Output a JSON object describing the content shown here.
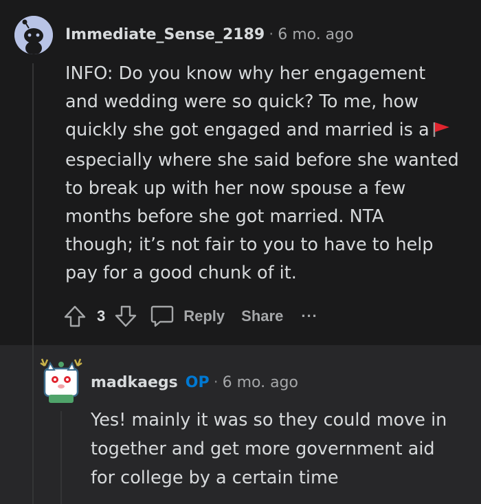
{
  "comment": {
    "username": "Immediate_Sense_2189",
    "separator": "·",
    "timestamp": "6 mo. ago",
    "avatar_icon": "reddit-snoo-avatar-icon",
    "body_lines": [
      "INFO: Do you know why her engagement",
      "and wedding were so quick? To me, how",
      "quickly she got engaged and married is a",
      "especially where she said before she wanted",
      "to break up with her now spouse a few",
      "months before she got married. NTA",
      "though; it’s not fair to you to have to help",
      "pay for a good chunk of it."
    ],
    "red_flag_icon": "red-flag-icon",
    "vote_count": "3",
    "reply_label": "Reply",
    "share_label": "Share",
    "more_label": "..."
  },
  "reply": {
    "username": "madkaegs",
    "op_badge": "OP",
    "separator": "·",
    "timestamp": "6 mo. ago",
    "avatar_icon": "snoo-cat-avatar-icon",
    "body_lines": [
      "Yes! mainly it was so they could move in",
      "together and get more government aid",
      "for college by a certain time"
    ]
  },
  "colors": {
    "background": "#1a1a1b",
    "reply_background": "#272729",
    "text": "#d7dadc",
    "meta": "#a5a7a9",
    "op_accent": "#0079d3",
    "flag_red": "#e0242e"
  }
}
